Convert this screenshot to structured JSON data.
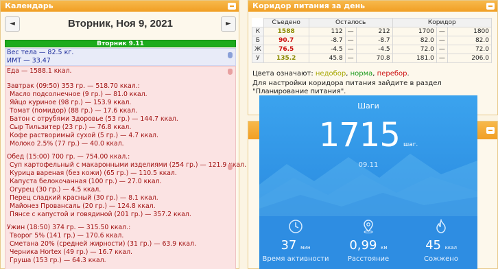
{
  "calendar": {
    "title": "Календарь",
    "date_title": "Вторник, Ноя 9, 2021",
    "prev_label": "◄",
    "next_label": "►",
    "day_bar": "Вторник 9.11",
    "weight": "Вес тела — 82.5 кг.",
    "bmi": "ИМТ — 33.47",
    "food_total": "Еда — 1588.1 ккал.",
    "meals": [
      {
        "header": "Завтрак (09:50) 353 гр. — 518.70 ккал.:",
        "items": [
          "Масло подсолнечное (9 гр.) — 81.0 ккал.",
          "Яйцо куриное (98 гр.) — 153.9 ккал.",
          "Томат (помидор) (88 гр.) — 17.6 ккал.",
          "Батон с отрубями Здоровье (53 гр.) — 144.7 ккал.",
          "Сыр Тильзитер (23 гр.) — 76.8 ккал.",
          "Кофе растворимый сухой (5 гр.) — 4.7 ккал.",
          "Молоко 2.5% (77 гр.) — 40.0 ккал."
        ]
      },
      {
        "header": "Обед (15:00) 700 гр. — 754.00 ккал.:",
        "items": [
          "Суп картофельный с макаронными изделиями (254 гр.) — 121.9 ккал.",
          "Курица вареная (без кожи) (65 гр.) — 110.5 ккал.",
          "Капуста белокочанная (100 гр.) — 27.0 ккал.",
          "Огурец (30 гр.) — 4.5 ккал.",
          "Перец сладкий красный (30 гр.) — 8.1 ккал.",
          "Майонез Провансаль (20 гр.) — 124.8 ккал.",
          "Пянсе с капустой и говядиной (201 гр.) — 357.2 ккал."
        ]
      },
      {
        "header": "Ужин (18:50) 374 гр. — 315.50 ккал.:",
        "items": [
          "Творог 5% (141 гр.) — 170.6 ккал.",
          "Сметана 20% (средней жирности) (31 гр.) — 63.9 ккал.",
          "Черника Hortex (49 гр.) — 16.7 ккал.",
          "Груша (153 гр.) — 64.3 ккал."
        ]
      }
    ]
  },
  "corridor": {
    "title": "Коридор питания за день",
    "headers": [
      "Съедено",
      "Осталось",
      "Коридор"
    ],
    "rows": [
      {
        "label": "К",
        "eaten": "1588",
        "left_from": "112",
        "left_to": "212",
        "corr_from": "1700",
        "corr_to": "1800",
        "color": "#8a8a00"
      },
      {
        "label": "Б",
        "eaten": "90.7",
        "left_from": "-8.7",
        "left_to": "-8.7",
        "corr_from": "82.0",
        "corr_to": "82.0",
        "color": "#cc1111"
      },
      {
        "label": "Ж",
        "eaten": "76.5",
        "left_from": "-4.5",
        "left_to": "-4.5",
        "corr_from": "72.0",
        "corr_to": "72.0",
        "color": "#cc1111"
      },
      {
        "label": "У",
        "eaten": "135.2",
        "left_from": "45.8",
        "left_to": "70.8",
        "corr_from": "181.0",
        "corr_to": "206.0",
        "color": "#8a8a00"
      }
    ],
    "dash": "—",
    "legend_prefix": "Цвета означают:",
    "legend_under": "недобор",
    "legend_norm": "норма",
    "legend_over": "перебор",
    "legend_colors": {
      "under": "#a6a600",
      "norm": "#1a9a1a",
      "over": "#cc1111"
    },
    "note": "Для настройки коридора питания зайдите в раздел \"Планирование питания\"."
  },
  "steps": {
    "title": "Шаги",
    "value": "1715",
    "unit": "шаг.",
    "date": "09.11",
    "stats": [
      {
        "icon": "clock-icon",
        "value": "37",
        "unit": "мин",
        "label": "Время активности"
      },
      {
        "icon": "location-pin-icon",
        "value": "0,99",
        "unit": "км",
        "label": "Расстояние"
      },
      {
        "icon": "flame-icon",
        "value": "45",
        "unit": "ккал",
        "label": "Сожжено"
      }
    ]
  }
}
